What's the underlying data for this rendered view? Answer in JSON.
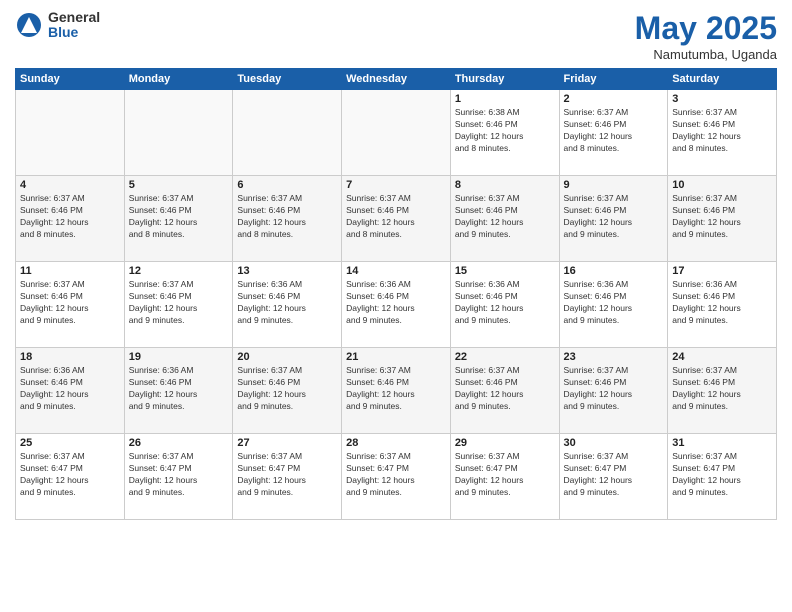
{
  "logo": {
    "general": "General",
    "blue": "Blue"
  },
  "title": "May 2025",
  "subtitle": "Namutumba, Uganda",
  "weekdays": [
    "Sunday",
    "Monday",
    "Tuesday",
    "Wednesday",
    "Thursday",
    "Friday",
    "Saturday"
  ],
  "weeks": [
    [
      {
        "day": "",
        "info": ""
      },
      {
        "day": "",
        "info": ""
      },
      {
        "day": "",
        "info": ""
      },
      {
        "day": "",
        "info": ""
      },
      {
        "day": "1",
        "info": "Sunrise: 6:38 AM\nSunset: 6:46 PM\nDaylight: 12 hours\nand 8 minutes."
      },
      {
        "day": "2",
        "info": "Sunrise: 6:37 AM\nSunset: 6:46 PM\nDaylight: 12 hours\nand 8 minutes."
      },
      {
        "day": "3",
        "info": "Sunrise: 6:37 AM\nSunset: 6:46 PM\nDaylight: 12 hours\nand 8 minutes."
      }
    ],
    [
      {
        "day": "4",
        "info": "Sunrise: 6:37 AM\nSunset: 6:46 PM\nDaylight: 12 hours\nand 8 minutes."
      },
      {
        "day": "5",
        "info": "Sunrise: 6:37 AM\nSunset: 6:46 PM\nDaylight: 12 hours\nand 8 minutes."
      },
      {
        "day": "6",
        "info": "Sunrise: 6:37 AM\nSunset: 6:46 PM\nDaylight: 12 hours\nand 8 minutes."
      },
      {
        "day": "7",
        "info": "Sunrise: 6:37 AM\nSunset: 6:46 PM\nDaylight: 12 hours\nand 8 minutes."
      },
      {
        "day": "8",
        "info": "Sunrise: 6:37 AM\nSunset: 6:46 PM\nDaylight: 12 hours\nand 9 minutes."
      },
      {
        "day": "9",
        "info": "Sunrise: 6:37 AM\nSunset: 6:46 PM\nDaylight: 12 hours\nand 9 minutes."
      },
      {
        "day": "10",
        "info": "Sunrise: 6:37 AM\nSunset: 6:46 PM\nDaylight: 12 hours\nand 9 minutes."
      }
    ],
    [
      {
        "day": "11",
        "info": "Sunrise: 6:37 AM\nSunset: 6:46 PM\nDaylight: 12 hours\nand 9 minutes."
      },
      {
        "day": "12",
        "info": "Sunrise: 6:37 AM\nSunset: 6:46 PM\nDaylight: 12 hours\nand 9 minutes."
      },
      {
        "day": "13",
        "info": "Sunrise: 6:36 AM\nSunset: 6:46 PM\nDaylight: 12 hours\nand 9 minutes."
      },
      {
        "day": "14",
        "info": "Sunrise: 6:36 AM\nSunset: 6:46 PM\nDaylight: 12 hours\nand 9 minutes."
      },
      {
        "day": "15",
        "info": "Sunrise: 6:36 AM\nSunset: 6:46 PM\nDaylight: 12 hours\nand 9 minutes."
      },
      {
        "day": "16",
        "info": "Sunrise: 6:36 AM\nSunset: 6:46 PM\nDaylight: 12 hours\nand 9 minutes."
      },
      {
        "day": "17",
        "info": "Sunrise: 6:36 AM\nSunset: 6:46 PM\nDaylight: 12 hours\nand 9 minutes."
      }
    ],
    [
      {
        "day": "18",
        "info": "Sunrise: 6:36 AM\nSunset: 6:46 PM\nDaylight: 12 hours\nand 9 minutes."
      },
      {
        "day": "19",
        "info": "Sunrise: 6:36 AM\nSunset: 6:46 PM\nDaylight: 12 hours\nand 9 minutes."
      },
      {
        "day": "20",
        "info": "Sunrise: 6:37 AM\nSunset: 6:46 PM\nDaylight: 12 hours\nand 9 minutes."
      },
      {
        "day": "21",
        "info": "Sunrise: 6:37 AM\nSunset: 6:46 PM\nDaylight: 12 hours\nand 9 minutes."
      },
      {
        "day": "22",
        "info": "Sunrise: 6:37 AM\nSunset: 6:46 PM\nDaylight: 12 hours\nand 9 minutes."
      },
      {
        "day": "23",
        "info": "Sunrise: 6:37 AM\nSunset: 6:46 PM\nDaylight: 12 hours\nand 9 minutes."
      },
      {
        "day": "24",
        "info": "Sunrise: 6:37 AM\nSunset: 6:46 PM\nDaylight: 12 hours\nand 9 minutes."
      }
    ],
    [
      {
        "day": "25",
        "info": "Sunrise: 6:37 AM\nSunset: 6:47 PM\nDaylight: 12 hours\nand 9 minutes."
      },
      {
        "day": "26",
        "info": "Sunrise: 6:37 AM\nSunset: 6:47 PM\nDaylight: 12 hours\nand 9 minutes."
      },
      {
        "day": "27",
        "info": "Sunrise: 6:37 AM\nSunset: 6:47 PM\nDaylight: 12 hours\nand 9 minutes."
      },
      {
        "day": "28",
        "info": "Sunrise: 6:37 AM\nSunset: 6:47 PM\nDaylight: 12 hours\nand 9 minutes."
      },
      {
        "day": "29",
        "info": "Sunrise: 6:37 AM\nSunset: 6:47 PM\nDaylight: 12 hours\nand 9 minutes."
      },
      {
        "day": "30",
        "info": "Sunrise: 6:37 AM\nSunset: 6:47 PM\nDaylight: 12 hours\nand 9 minutes."
      },
      {
        "day": "31",
        "info": "Sunrise: 6:37 AM\nSunset: 6:47 PM\nDaylight: 12 hours\nand 9 minutes."
      }
    ]
  ]
}
